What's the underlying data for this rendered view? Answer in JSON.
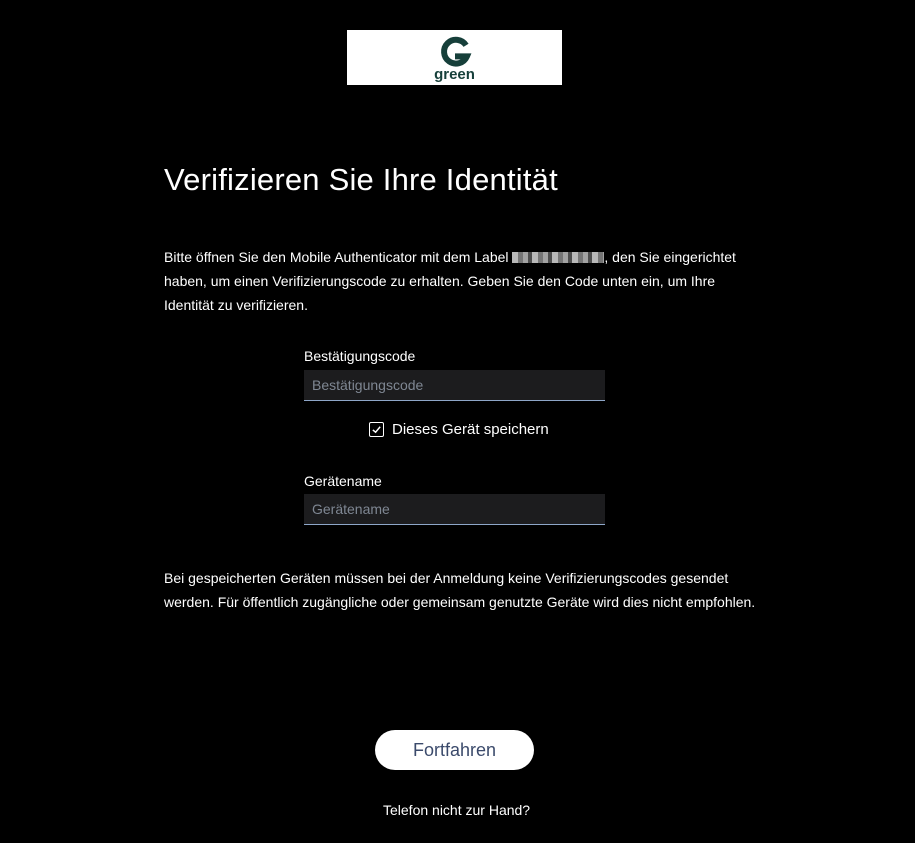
{
  "logo": {
    "text": "green",
    "brand_color": "#163f3a"
  },
  "page": {
    "title": "Verifizieren Sie Ihre Identität"
  },
  "intro": {
    "before_label": "Bitte öffnen Sie den Mobile Authenticator mit dem Label ",
    "after_label": ", den Sie eingerichtet haben, um einen Verifizierungscode zu erhalten. Geben Sie den Code unten ein, um Ihre Identität zu verifizieren."
  },
  "code_field": {
    "label": "Bestätigungscode",
    "placeholder": "Bestätigungscode",
    "value": ""
  },
  "remember": {
    "label": "Dieses Gerät speichern",
    "checked": true
  },
  "device_field": {
    "label": "Gerätename",
    "placeholder": "Gerätename",
    "value": ""
  },
  "note": "Bei gespeicherten Geräten müssen bei der Anmeldung keine Verifizierungscodes gesendet werden. Für öffentlich zugängliche oder gemeinsam genutzte Geräte wird dies nicht empfohlen.",
  "continue_button": {
    "label": "Fortfahren"
  },
  "no_phone_link": {
    "label": "Telefon nicht zur Hand?"
  }
}
